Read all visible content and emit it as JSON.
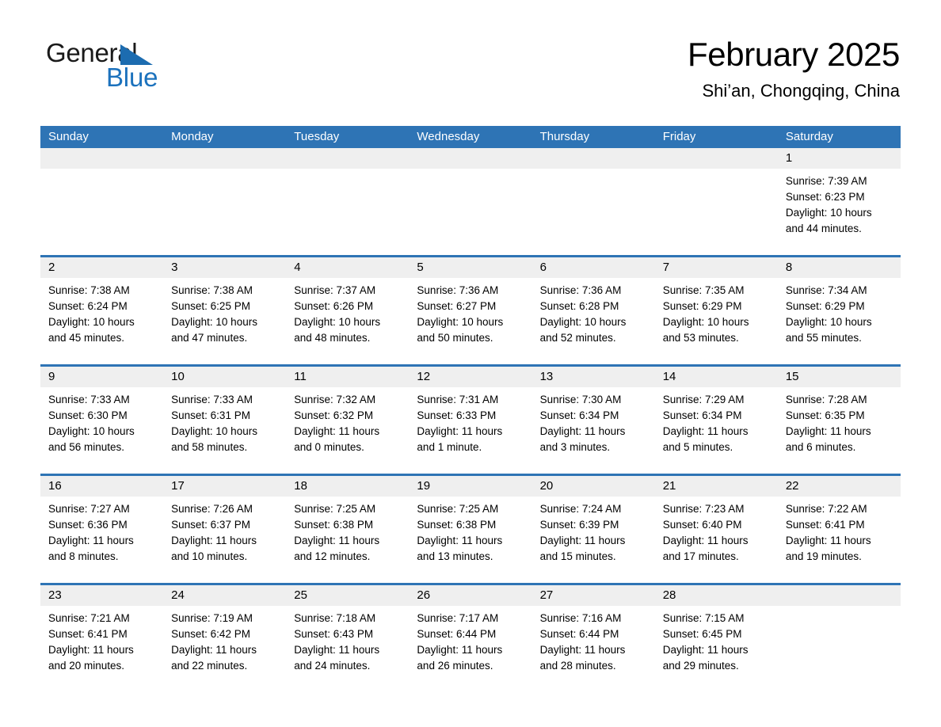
{
  "brand": {
    "word1": "General",
    "word2": "Blue",
    "triangle_color": "#1c6cb0",
    "blue_text_color": "#1c72bd"
  },
  "header": {
    "title": "February 2025",
    "subtitle": "Shi’an, Chongqing, China"
  },
  "theme": {
    "header_blue": "#2e74b5",
    "daynum_band": "#efefef",
    "separator_blue": "#2e74b5"
  },
  "weekdays": [
    "Sunday",
    "Monday",
    "Tuesday",
    "Wednesday",
    "Thursday",
    "Friday",
    "Saturday"
  ],
  "weeks": [
    [
      {
        "day": "",
        "sunrise": "",
        "sunset": "",
        "daylight1": "",
        "daylight2": ""
      },
      {
        "day": "",
        "sunrise": "",
        "sunset": "",
        "daylight1": "",
        "daylight2": ""
      },
      {
        "day": "",
        "sunrise": "",
        "sunset": "",
        "daylight1": "",
        "daylight2": ""
      },
      {
        "day": "",
        "sunrise": "",
        "sunset": "",
        "daylight1": "",
        "daylight2": ""
      },
      {
        "day": "",
        "sunrise": "",
        "sunset": "",
        "daylight1": "",
        "daylight2": ""
      },
      {
        "day": "",
        "sunrise": "",
        "sunset": "",
        "daylight1": "",
        "daylight2": ""
      },
      {
        "day": "1",
        "sunrise": "Sunrise: 7:39 AM",
        "sunset": "Sunset: 6:23 PM",
        "daylight1": "Daylight: 10 hours",
        "daylight2": "and 44 minutes."
      }
    ],
    [
      {
        "day": "2",
        "sunrise": "Sunrise: 7:38 AM",
        "sunset": "Sunset: 6:24 PM",
        "daylight1": "Daylight: 10 hours",
        "daylight2": "and 45 minutes."
      },
      {
        "day": "3",
        "sunrise": "Sunrise: 7:38 AM",
        "sunset": "Sunset: 6:25 PM",
        "daylight1": "Daylight: 10 hours",
        "daylight2": "and 47 minutes."
      },
      {
        "day": "4",
        "sunrise": "Sunrise: 7:37 AM",
        "sunset": "Sunset: 6:26 PM",
        "daylight1": "Daylight: 10 hours",
        "daylight2": "and 48 minutes."
      },
      {
        "day": "5",
        "sunrise": "Sunrise: 7:36 AM",
        "sunset": "Sunset: 6:27 PM",
        "daylight1": "Daylight: 10 hours",
        "daylight2": "and 50 minutes."
      },
      {
        "day": "6",
        "sunrise": "Sunrise: 7:36 AM",
        "sunset": "Sunset: 6:28 PM",
        "daylight1": "Daylight: 10 hours",
        "daylight2": "and 52 minutes."
      },
      {
        "day": "7",
        "sunrise": "Sunrise: 7:35 AM",
        "sunset": "Sunset: 6:29 PM",
        "daylight1": "Daylight: 10 hours",
        "daylight2": "and 53 minutes."
      },
      {
        "day": "8",
        "sunrise": "Sunrise: 7:34 AM",
        "sunset": "Sunset: 6:29 PM",
        "daylight1": "Daylight: 10 hours",
        "daylight2": "and 55 minutes."
      }
    ],
    [
      {
        "day": "9",
        "sunrise": "Sunrise: 7:33 AM",
        "sunset": "Sunset: 6:30 PM",
        "daylight1": "Daylight: 10 hours",
        "daylight2": "and 56 minutes."
      },
      {
        "day": "10",
        "sunrise": "Sunrise: 7:33 AM",
        "sunset": "Sunset: 6:31 PM",
        "daylight1": "Daylight: 10 hours",
        "daylight2": "and 58 minutes."
      },
      {
        "day": "11",
        "sunrise": "Sunrise: 7:32 AM",
        "sunset": "Sunset: 6:32 PM",
        "daylight1": "Daylight: 11 hours",
        "daylight2": "and 0 minutes."
      },
      {
        "day": "12",
        "sunrise": "Sunrise: 7:31 AM",
        "sunset": "Sunset: 6:33 PM",
        "daylight1": "Daylight: 11 hours",
        "daylight2": "and 1 minute."
      },
      {
        "day": "13",
        "sunrise": "Sunrise: 7:30 AM",
        "sunset": "Sunset: 6:34 PM",
        "daylight1": "Daylight: 11 hours",
        "daylight2": "and 3 minutes."
      },
      {
        "day": "14",
        "sunrise": "Sunrise: 7:29 AM",
        "sunset": "Sunset: 6:34 PM",
        "daylight1": "Daylight: 11 hours",
        "daylight2": "and 5 minutes."
      },
      {
        "day": "15",
        "sunrise": "Sunrise: 7:28 AM",
        "sunset": "Sunset: 6:35 PM",
        "daylight1": "Daylight: 11 hours",
        "daylight2": "and 6 minutes."
      }
    ],
    [
      {
        "day": "16",
        "sunrise": "Sunrise: 7:27 AM",
        "sunset": "Sunset: 6:36 PM",
        "daylight1": "Daylight: 11 hours",
        "daylight2": "and 8 minutes."
      },
      {
        "day": "17",
        "sunrise": "Sunrise: 7:26 AM",
        "sunset": "Sunset: 6:37 PM",
        "daylight1": "Daylight: 11 hours",
        "daylight2": "and 10 minutes."
      },
      {
        "day": "18",
        "sunrise": "Sunrise: 7:25 AM",
        "sunset": "Sunset: 6:38 PM",
        "daylight1": "Daylight: 11 hours",
        "daylight2": "and 12 minutes."
      },
      {
        "day": "19",
        "sunrise": "Sunrise: 7:25 AM",
        "sunset": "Sunset: 6:38 PM",
        "daylight1": "Daylight: 11 hours",
        "daylight2": "and 13 minutes."
      },
      {
        "day": "20",
        "sunrise": "Sunrise: 7:24 AM",
        "sunset": "Sunset: 6:39 PM",
        "daylight1": "Daylight: 11 hours",
        "daylight2": "and 15 minutes."
      },
      {
        "day": "21",
        "sunrise": "Sunrise: 7:23 AM",
        "sunset": "Sunset: 6:40 PM",
        "daylight1": "Daylight: 11 hours",
        "daylight2": "and 17 minutes."
      },
      {
        "day": "22",
        "sunrise": "Sunrise: 7:22 AM",
        "sunset": "Sunset: 6:41 PM",
        "daylight1": "Daylight: 11 hours",
        "daylight2": "and 19 minutes."
      }
    ],
    [
      {
        "day": "23",
        "sunrise": "Sunrise: 7:21 AM",
        "sunset": "Sunset: 6:41 PM",
        "daylight1": "Daylight: 11 hours",
        "daylight2": "and 20 minutes."
      },
      {
        "day": "24",
        "sunrise": "Sunrise: 7:19 AM",
        "sunset": "Sunset: 6:42 PM",
        "daylight1": "Daylight: 11 hours",
        "daylight2": "and 22 minutes."
      },
      {
        "day": "25",
        "sunrise": "Sunrise: 7:18 AM",
        "sunset": "Sunset: 6:43 PM",
        "daylight1": "Daylight: 11 hours",
        "daylight2": "and 24 minutes."
      },
      {
        "day": "26",
        "sunrise": "Sunrise: 7:17 AM",
        "sunset": "Sunset: 6:44 PM",
        "daylight1": "Daylight: 11 hours",
        "daylight2": "and 26 minutes."
      },
      {
        "day": "27",
        "sunrise": "Sunrise: 7:16 AM",
        "sunset": "Sunset: 6:44 PM",
        "daylight1": "Daylight: 11 hours",
        "daylight2": "and 28 minutes."
      },
      {
        "day": "28",
        "sunrise": "Sunrise: 7:15 AM",
        "sunset": "Sunset: 6:45 PM",
        "daylight1": "Daylight: 11 hours",
        "daylight2": "and 29 minutes."
      },
      {
        "day": "",
        "sunrise": "",
        "sunset": "",
        "daylight1": "",
        "daylight2": ""
      }
    ]
  ]
}
